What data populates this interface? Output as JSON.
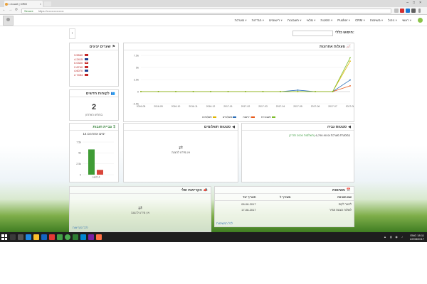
{
  "browser": {
    "tab_title": "r-Count | CRM",
    "secure_label": "Secure",
    "url": "https://•••••••••••••••••"
  },
  "nav": {
    "items": [
      "ראשי",
      "ניהול",
      "משימות",
      "CRM",
      "Pusher",
      "הזמנות",
      "מלאי",
      "חשבונות",
      "רישומים",
      "הגדרות",
      "מערכת"
    ]
  },
  "search": {
    "label": "חיפוש כללי:"
  },
  "currency": {
    "title": "שערים יציגים",
    "rows": [
      {
        "value": "3.5560",
        "flag_color": "#c62828"
      },
      {
        "value": "4.2415",
        "flag_color": "#1e3f8f"
      },
      {
        "value": "0.0320",
        "flag_color": "#ffffff"
      },
      {
        "value": "2.8740",
        "flag_color": "#c62828"
      },
      {
        "value": "4.6070",
        "flag_color": "#1e3f8f"
      },
      {
        "value": "2.7454",
        "flag_color": "#c62828"
      }
    ]
  },
  "leads": {
    "title": "לקוחות חדשים",
    "count": "2",
    "sub": "בחודש האחרון"
  },
  "activity": {
    "title": "פעולות אחרונות",
    "legend": [
      "חשבוניות",
      "רכישות",
      "משלוחים",
      "תשלומים"
    ]
  },
  "collection": {
    "title": "גביית חובות",
    "subtitle": "14 ימים אחרונים"
  },
  "payments_status": {
    "title": "סטטוס תשלומים",
    "empty": "אין מידע להצגה"
  },
  "collection_status": {
    "title": "סטטוס גביה",
    "line_value": "₪ 6,790.90",
    "line_label": "במסגרת מערכת",
    "line_green": "(השלמות 2000 סה\"כ)"
  },
  "my_calls": {
    "title": "הקריאות שלי",
    "empty": "אין מידע להצגה",
    "link": "לכל הקריאות"
  },
  "tasks": {
    "title": "משימות",
    "columns": [
      "שם משימה",
      "משוייך ל",
      "תאריך יעד"
    ],
    "rows": [
      {
        "name": "לחזור לקוח",
        "assignee": "",
        "date": "08-08-2017"
      },
      {
        "name": "לשלוח הצעת מחיר",
        "assignee": "",
        "date": "17-08-2017"
      }
    ],
    "link": "לכל המשימות"
  },
  "taskbar": {
    "lang": "ENG",
    "time": "18:11",
    "date": "22/08/2017"
  },
  "chart_data": [
    {
      "type": "line",
      "title": "",
      "x": [
        "2016-08",
        "2016-09",
        "2016-10",
        "2016-11",
        "2016-12",
        "2017-01",
        "2017-02",
        "2017-03",
        "2017-04",
        "2017-05",
        "2017-06",
        "2017-07",
        "2017-08"
      ],
      "ylim": [
        -2.5,
        7.5
      ],
      "yticks": [
        "7.5k",
        "5k",
        "2.5k",
        "0",
        "-2.5k"
      ],
      "series": [
        {
          "name": "חשבוניות",
          "color": "#2e6fb7",
          "values": [
            0,
            0,
            0,
            0,
            0,
            0,
            0,
            0,
            0,
            0.3,
            0,
            0,
            2.4
          ]
        },
        {
          "name": "רכישות",
          "color": "#e85a1b",
          "values": [
            0,
            0,
            0,
            0,
            0,
            0,
            0,
            0,
            0,
            0,
            0,
            0,
            1.2
          ]
        },
        {
          "name": "משלוחים",
          "color": "#e0b500",
          "values": [
            0,
            0,
            0,
            0,
            0,
            0,
            0,
            0,
            0,
            0,
            0,
            0,
            6.3
          ]
        },
        {
          "name": "תשלומים",
          "color": "#7cbd2a",
          "values": [
            0,
            0,
            0,
            0,
            0,
            0,
            0,
            0,
            0,
            0,
            0,
            0,
            7.0
          ]
        }
      ]
    },
    {
      "type": "bar",
      "title": "",
      "categories": [
        "Last 14"
      ],
      "ylim": [
        0,
        7500
      ],
      "yticks": [
        "7.5k",
        "5k",
        "2.5k",
        "0"
      ],
      "series": [
        {
          "name": "",
          "color": "#3f9c35",
          "values": [
            5800
          ]
        },
        {
          "name": "",
          "color": "#d9453a",
          "values": [
            1100
          ]
        }
      ]
    }
  ]
}
